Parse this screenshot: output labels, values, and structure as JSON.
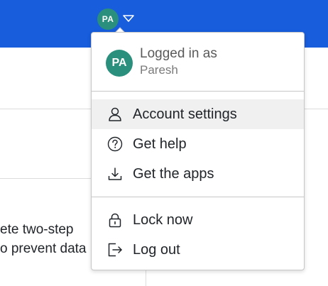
{
  "header": {
    "avatar_initials": "PA",
    "accent_color": "#175ddc",
    "avatar_color": "#2a8f7c"
  },
  "background": {
    "text_line_1": "ete two-step",
    "text_line_2": "o prevent data"
  },
  "account_menu": {
    "profile": {
      "initials": "PA",
      "logged_in_label": "Logged in as",
      "username": "Paresh"
    },
    "items": [
      {
        "label": "Account settings",
        "icon": "user-icon",
        "highlighted": true
      },
      {
        "label": "Get help",
        "icon": "question-circle-icon",
        "highlighted": false
      },
      {
        "label": "Get the apps",
        "icon": "download-icon",
        "highlighted": false
      }
    ],
    "secondary_items": [
      {
        "label": "Lock now",
        "icon": "lock-icon"
      },
      {
        "label": "Log out",
        "icon": "sign-out-icon"
      }
    ]
  }
}
